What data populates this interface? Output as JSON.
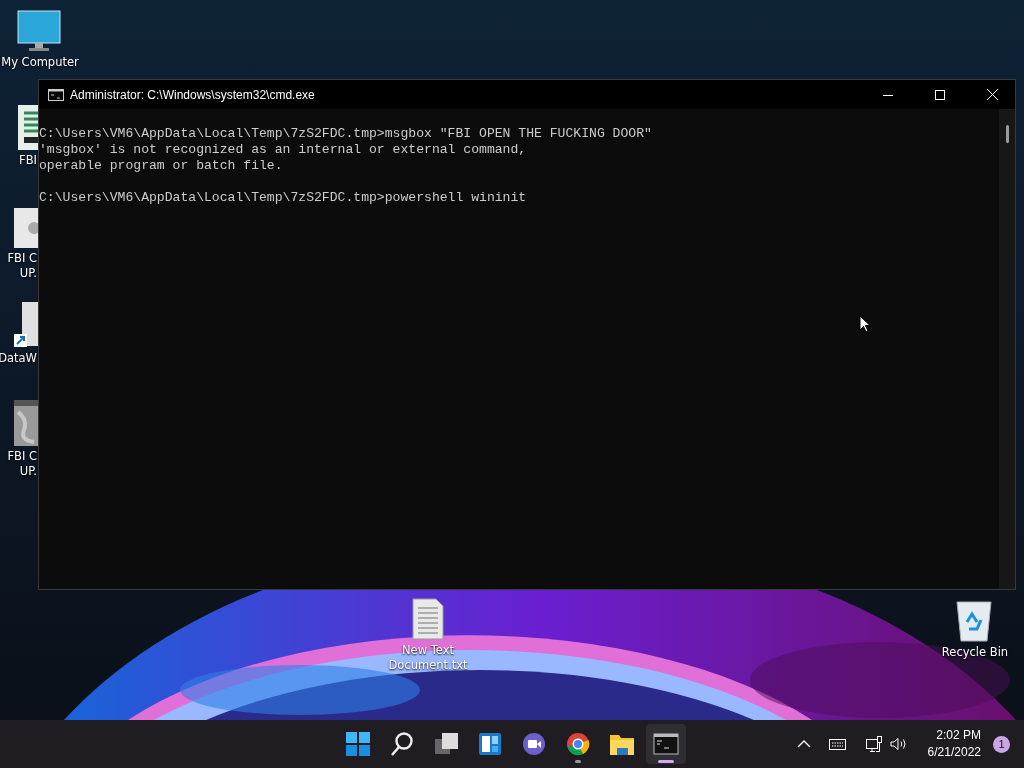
{
  "desktop_icons": [
    {
      "kind": "monitor",
      "label": [
        "My Computer"
      ]
    },
    {
      "kind": "fbi-app",
      "label": [
        "FBI"
      ]
    },
    {
      "kind": "gear-file",
      "label": [
        "FBI C",
        "UP."
      ]
    },
    {
      "kind": "shortcut",
      "label": [
        "DataW"
      ]
    },
    {
      "kind": "image-file",
      "label": [
        "FBI C",
        "UP."
      ]
    },
    {
      "kind": "text-file",
      "label": [
        "New Text",
        "Document.txt"
      ]
    },
    {
      "kind": "recycle-bin",
      "label": [
        "Recycle Bin"
      ]
    }
  ],
  "window": {
    "title": "Administrator: C:\\Windows\\system32\\cmd.exe",
    "console_blocks": [
      [
        "C:\\Users\\VM6\\AppData\\Local\\Temp\\7zS2FDC.tmp>msgbox \"FBI OPEN THE FUCKING DOOR\"",
        "'msgbox' is not recognized as an internal or external command,",
        "operable program or batch file."
      ],
      [
        "C:\\Users\\VM6\\AppData\\Local\\Temp\\7zS2FDC.tmp>powershell wininit"
      ]
    ]
  },
  "taskbar": {
    "items": [
      {
        "kind": "start",
        "running": false,
        "active": false
      },
      {
        "kind": "search",
        "running": false,
        "active": false
      },
      {
        "kind": "task-view",
        "running": false,
        "active": false
      },
      {
        "kind": "widgets",
        "running": false,
        "active": false
      },
      {
        "kind": "chat",
        "running": false,
        "active": false
      },
      {
        "kind": "chrome",
        "running": true,
        "active": false
      },
      {
        "kind": "explorer",
        "running": false,
        "active": false
      },
      {
        "kind": "terminal",
        "running": true,
        "active": true
      }
    ],
    "tray": {
      "time": "2:02 PM",
      "date": "6/21/2022",
      "notifications": "1"
    }
  }
}
